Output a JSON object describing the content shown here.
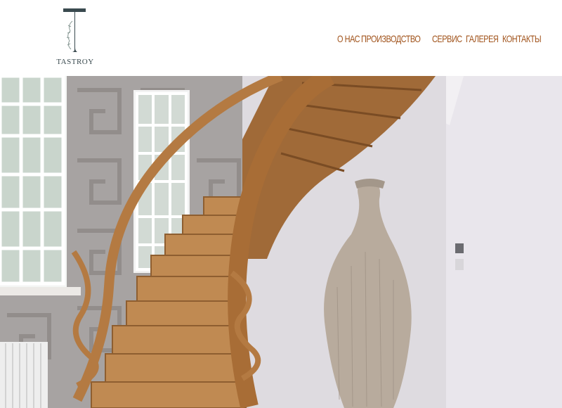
{
  "brand": {
    "logo_letter": "T",
    "name": "TASTROY"
  },
  "nav": {
    "items": [
      {
        "id": "about",
        "label": "О НАС"
      },
      {
        "id": "production",
        "label": "ПРОИЗВОДСТВО"
      },
      {
        "id": "service",
        "label": "СЕРВИС"
      },
      {
        "id": "gallery",
        "label": "ГАЛЕРЕЯ"
      },
      {
        "id": "contacts",
        "label": "КОНТАКТЫ"
      }
    ]
  },
  "colors": {
    "nav_text": "#a0521a",
    "logo": "#3a4a4f",
    "wood": "#b9834a"
  },
  "hero": {
    "image": "wooden-spiral-staircase-with-vase"
  }
}
